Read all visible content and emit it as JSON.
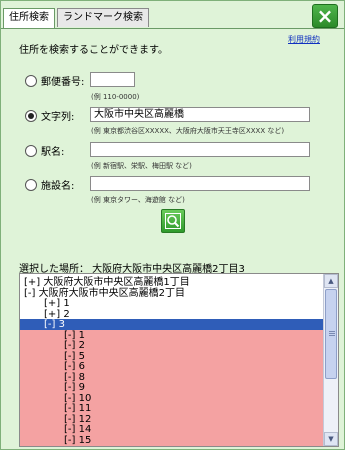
{
  "tabs": [
    {
      "label": "住所検索",
      "active": true
    },
    {
      "label": "ランドマーク検索",
      "active": false
    }
  ],
  "close_icon": "×",
  "help_link": "利用規約",
  "intro": "住所を検索することができます。",
  "fields": {
    "postal": {
      "label": "郵便番号:",
      "value": "",
      "example": "(例 110-0000)",
      "checked": false
    },
    "text": {
      "label": "文字列:",
      "value": "大阪市中央区高麗橋",
      "example": "(例 東京都渋谷区XXXXX、大阪府大阪市天王寺区XXXX など)",
      "checked": true
    },
    "station": {
      "label": "駅名:",
      "value": "",
      "example": "(例 新宿駅、栄駅、梅田駅 など)",
      "checked": false
    },
    "facility": {
      "label": "施設名:",
      "value": "",
      "example": "(例 東京タワー、海遊館 など)",
      "checked": false
    }
  },
  "selected_place": "選択した場所： 大阪府大阪市中央区高麗橋2丁目3",
  "tree": [
    {
      "text": "[+] 大阪府大阪市中央区高麗橋1丁目",
      "style": ""
    },
    {
      "text": "[-] 大阪府大阪市中央区高麗橋2丁目",
      "style": ""
    },
    {
      "text": "[+] 1",
      "style": ""
    },
    {
      "text": "[+] 2",
      "style": ""
    },
    {
      "text": "[-] 3",
      "style": "sel"
    },
    {
      "text": "[-] 1",
      "style": "pink"
    },
    {
      "text": "[-] 2",
      "style": "pink"
    },
    {
      "text": "[-] 5",
      "style": "pink"
    },
    {
      "text": "[-] 6",
      "style": "pink"
    },
    {
      "text": "[-] 8",
      "style": "pink"
    },
    {
      "text": "[-] 9",
      "style": "pink"
    },
    {
      "text": "[-] 10",
      "style": "pink"
    },
    {
      "text": "[-] 11",
      "style": "pink"
    },
    {
      "text": "[-] 12",
      "style": "pink"
    },
    {
      "text": "[-] 14",
      "style": "pink"
    },
    {
      "text": "[-] 15",
      "style": "pink"
    }
  ],
  "icons": {
    "close": "close-icon",
    "search": "search-icon",
    "scroll_up": "▲",
    "scroll_down": "▼"
  }
}
